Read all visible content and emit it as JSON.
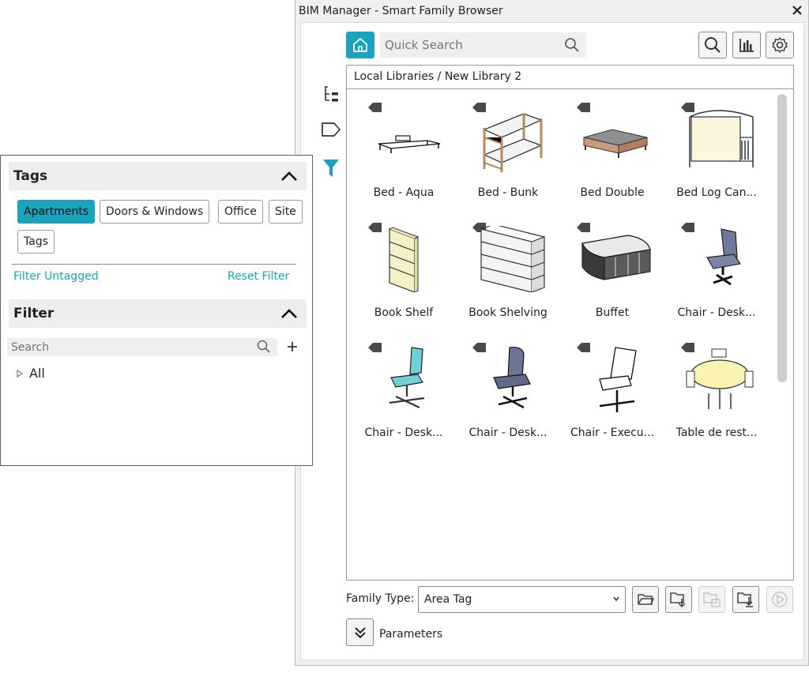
{
  "window": {
    "title": "BIM Manager - Smart Family Browser"
  },
  "toolbar": {
    "search_placeholder": "Quick Search",
    "icons": [
      "home-icon",
      "magnifier-icon",
      "search-icon",
      "stats-icon",
      "gear-icon"
    ]
  },
  "side_icons": [
    "tree-icon",
    "tag-icon",
    "filter-icon"
  ],
  "breadcrumb": "Local Libraries / New Library 2",
  "items": [
    {
      "label": "Bed - Aqua",
      "thumb": "bed-flat"
    },
    {
      "label": "Bed - Bunk",
      "thumb": "bunk-bed"
    },
    {
      "label": "Bed Double",
      "thumb": "double-bed"
    },
    {
      "label": "Bed Log Can...",
      "thumb": "canopy-bed"
    },
    {
      "label": "Book Shelf",
      "thumb": "book-shelf"
    },
    {
      "label": "Book Shelving",
      "thumb": "book-shelving"
    },
    {
      "label": "Buffet",
      "thumb": "buffet"
    },
    {
      "label": "Chair - Desk...",
      "thumb": "chair-blue-grey"
    },
    {
      "label": "Chair - Desk...",
      "thumb": "chair-cyan"
    },
    {
      "label": "Chair - Desk...",
      "thumb": "chair-dark"
    },
    {
      "label": "Chair - Execu...",
      "thumb": "chair-executive"
    },
    {
      "label": "Table de rest...",
      "thumb": "round-table"
    }
  ],
  "bottom": {
    "family_type_label": "Family Type:",
    "family_type_value": "Area Tag",
    "parameters_label": "Parameters",
    "buttons": [
      "open-folder-icon",
      "load-folder-icon",
      "reload-disabled-icon",
      "save-folder-icon",
      "play-disabled-icon"
    ]
  },
  "tags_panel": {
    "title": "Tags",
    "chips": [
      {
        "label": "Apartments",
        "active": true
      },
      {
        "label": "Doors & Windows",
        "active": false
      },
      {
        "label": "Office",
        "active": false
      },
      {
        "label": "Site",
        "active": false
      },
      {
        "label": "Tags",
        "active": false
      }
    ],
    "filter_untagged": "Filter Untagged",
    "reset_filter": "Reset Filter"
  },
  "filter_panel": {
    "title": "Filter",
    "search_placeholder": "Search",
    "tree_root": "All"
  },
  "colors": {
    "accent": "#1aa3bd",
    "panel_bg": "#f0f0f0",
    "header_bg": "#eeeeee"
  }
}
